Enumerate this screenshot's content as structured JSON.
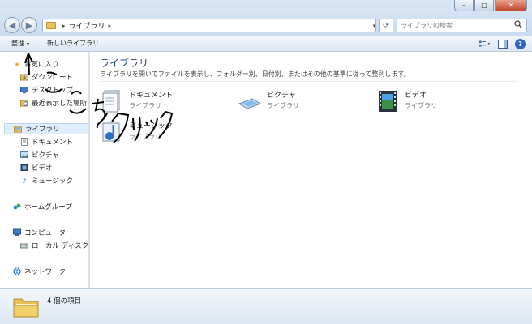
{
  "window": {
    "minimize_symbol": "–",
    "maximize_symbol": "□",
    "close_symbol": "✕"
  },
  "nav": {
    "back_symbol": "◀",
    "forward_symbol": "▶"
  },
  "address": {
    "separator": "▸",
    "crumb": "ライブラリ",
    "crumb_sep": "▸",
    "dropdown_symbol": "▾",
    "refresh_symbol": "⟳"
  },
  "search": {
    "placeholder": "ライブラリの検索",
    "icon": "search-icon"
  },
  "commandbar": {
    "organize_label": "整理",
    "organize_dropdown": "▾",
    "new_library_label": "新しいライブラリ"
  },
  "sidebar": {
    "favorites": {
      "label": "お気に入り",
      "items": [
        {
          "label": "ダウンロード",
          "icon": "download-folder-icon"
        },
        {
          "label": "デスクトップ",
          "icon": "desktop-icon"
        },
        {
          "label": "最近表示した場所",
          "icon": "recent-places-icon"
        }
      ]
    },
    "libraries": {
      "label": "ライブラリ",
      "items": [
        {
          "label": "ドキュメント",
          "icon": "documents-icon"
        },
        {
          "label": "ピクチャ",
          "icon": "pictures-icon"
        },
        {
          "label": "ビデオ",
          "icon": "videos-icon"
        },
        {
          "label": "ミュージック",
          "icon": "music-icon"
        }
      ]
    },
    "homegroup": {
      "label": "ホームグループ"
    },
    "computer": {
      "label": "コンピューター",
      "items": [
        {
          "label": "ローカル ディスク (",
          "icon": "local-disk-icon"
        }
      ]
    },
    "network": {
      "label": "ネットワーク"
    }
  },
  "main": {
    "title": "ライブラリ",
    "description": "ライブラリを開いてファイルを表示し、フォルダー別、日付別、またはその他の基準に従って整列します。",
    "libraries": [
      {
        "name": "ドキュメント",
        "type": "ライブラリ"
      },
      {
        "name": "ピクチャ",
        "type": "ライブラリ"
      },
      {
        "name": "ビデオ",
        "type": "ライブラリ"
      },
      {
        "name": "ミュージック",
        "type": "ライブラリ"
      }
    ]
  },
  "status": {
    "item_count": "4 個の項目"
  },
  "annotation": {
    "text1": "ここ",
    "text2": "をクリック"
  },
  "colors": {
    "accent": "#1e3f7a",
    "selection": "#dfeefc",
    "folder": "#e7c25a"
  }
}
